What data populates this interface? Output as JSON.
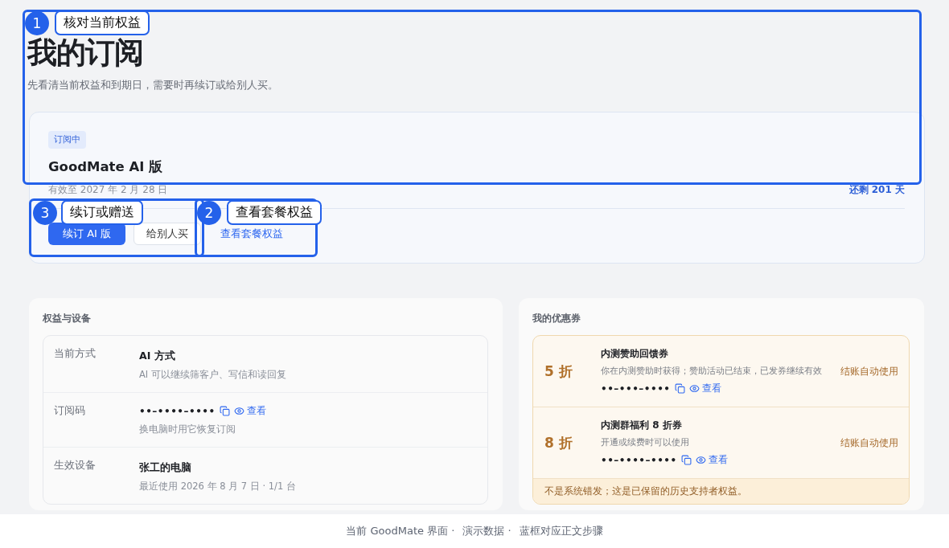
{
  "page": {
    "title": "我的订阅",
    "subtitle": "先看清当前权益和到期日，需要时再续订或给别人买。"
  },
  "subscription": {
    "status": "订阅中",
    "product": "GoodMate AI 版",
    "expiry": "有效至 2027 年 2 月 28 日",
    "remaining": "还剩 201 天",
    "actions": [
      {
        "kind": "primary",
        "label": "续订 AI 版"
      },
      {
        "kind": "secondary",
        "label": "给别人买"
      },
      {
        "kind": "link",
        "label": "查看套餐权益"
      }
    ]
  },
  "benefits": {
    "title": "权益与设备",
    "rows": [
      {
        "kind": "text",
        "label": "当前方式",
        "value": "AI 方式",
        "note": "AI 可以继续筛客户、写信和读回复"
      },
      {
        "kind": "code",
        "label": "订阅码",
        "value": "••–••••–••••",
        "reveal": "查看",
        "note": "换电脑时用它恢复订阅"
      },
      {
        "kind": "text",
        "label": "生效设备",
        "value": "张工的电脑",
        "note": "最近使用 2026 年 8 月 7 日 · 1/1 台"
      }
    ]
  },
  "coupons": {
    "title": "我的优惠券",
    "items": [
      {
        "discount": "5 折",
        "name": "内测赞助回馈券",
        "desc": "你在内测赞助时获得；赞助活动已结束，已发券继续有效",
        "code": "••–•••–••••",
        "reveal": "查看",
        "usage": "结账自动使用"
      },
      {
        "discount": "8 折",
        "name": "内测群福利 8 折券",
        "desc": "开通或续费时可以使用",
        "code": "••–••••–••••",
        "reveal": "查看",
        "usage": "结账自动使用"
      }
    ],
    "notice": "不是系统错发；这是已保留的历史支持者权益。"
  },
  "footer": [
    "当前 GoodMate 界面 ·",
    "演示数据 ·",
    "蓝框对应正文步骤"
  ],
  "annotations": [
    {
      "number": "1",
      "label": "核对当前权益"
    },
    {
      "number": "3",
      "label": "续订或赠送"
    },
    {
      "number": "2",
      "label": "查看套餐权益"
    }
  ]
}
